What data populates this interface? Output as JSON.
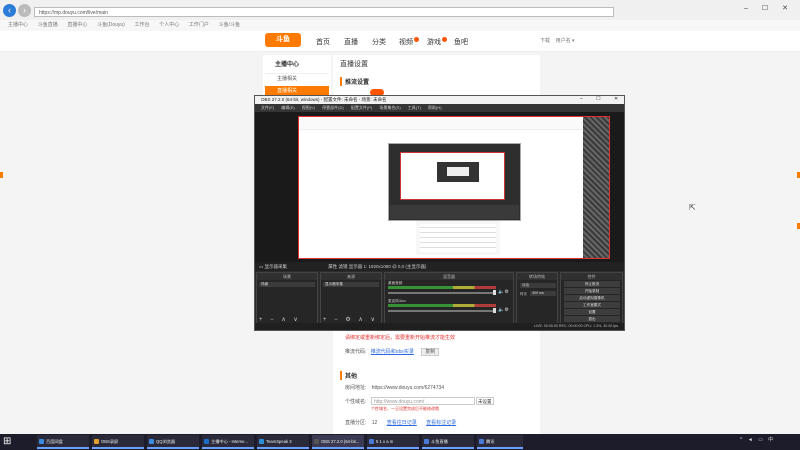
{
  "browser": {
    "address": "https://mp.douyu.com/live/main",
    "window_controls": "– ☐ ✕",
    "tabs": [
      "主播中心",
      "斗鱼直播",
      "直播中心",
      "斗鱼(Douyu)",
      "工作台",
      "个人中心",
      "工作门户",
      "斗鱼/斗鱼"
    ]
  },
  "site": {
    "logo": "斗鱼",
    "nav": [
      "首页",
      "直播",
      "分类",
      "视频",
      "游戏",
      "鱼吧"
    ],
    "user": "下载",
    "user_name": "用户名"
  },
  "sidebar": {
    "title": "主播中心",
    "items": [
      "主播相关",
      "直播相关"
    ]
  },
  "main": {
    "title": "直播设置",
    "section1_title": "推流设置"
  },
  "obs": {
    "title": "OBS 27.2.0 (64-bit, windows) - 配置文件: 未命名 - 场景: 未命名",
    "window_controls": "– ☐ ✕",
    "menu": [
      "文件(F)",
      "编辑(E)",
      "视图(V)",
      "停靠部件(D)",
      "配置文件(P)",
      "场景集合(S)",
      "工具(T)",
      "帮助(H)"
    ],
    "scene_bar": "显示器采集",
    "scene_bar_right": "属性  滤镜  显示器 1: 1920x1080 @ 0,0 (主显示器)",
    "docks": {
      "scenes": "场景",
      "sources": "来源",
      "mixer": "混音器",
      "transitions": "转场特效",
      "controls": "控件"
    },
    "scene_item": "场景",
    "source_item": "显示器采集",
    "mixer_tracks": [
      "桌面音频",
      "麦克风/Aux"
    ],
    "transition_value": "淡出",
    "duration_label": "时长",
    "duration_value": "300 ms",
    "controls": [
      "停止推流",
      "开始录制",
      "启动虚拟摄像机",
      "工作室模式",
      "设置",
      "退出"
    ],
    "status": "LIVE: 00:00:00   REC: 00:00:00   CPU: 1.3%, 30.00 fps"
  },
  "lower": {
    "red_note": "请绑定或重新绑定后，需要重新开始推流才能生效",
    "pc_label": "推流代码:",
    "pc_link": "推流代码和obs实录",
    "pc_btn": "复制",
    "other_title": "其他",
    "room_label": "房间地址:",
    "room_url": "https://www.douyu.com/6274734",
    "custom_label": "个性域名:",
    "custom_placeholder": "http://www.douyu.com/",
    "custom_select": "未设置",
    "custom_hint": "个性域名，一旦设置完成后不能修改哦",
    "set_label": "直播分区:",
    "set_value": "12",
    "set_link1": "查看往日记录",
    "set_link2": "查看标注记录"
  },
  "taskbar": {
    "start_glyph": "⊞",
    "items": [
      "百度网盘",
      "OBS录屏",
      "QQ浏览器",
      "主播中心 - Interne...",
      "TeamSpeak 3",
      "OBS 27.2.0 (64-bit...",
      "5 1 x a m",
      "斗鱼直播",
      "腾讯"
    ],
    "tray": "^ ◄ ▭ 中"
  }
}
